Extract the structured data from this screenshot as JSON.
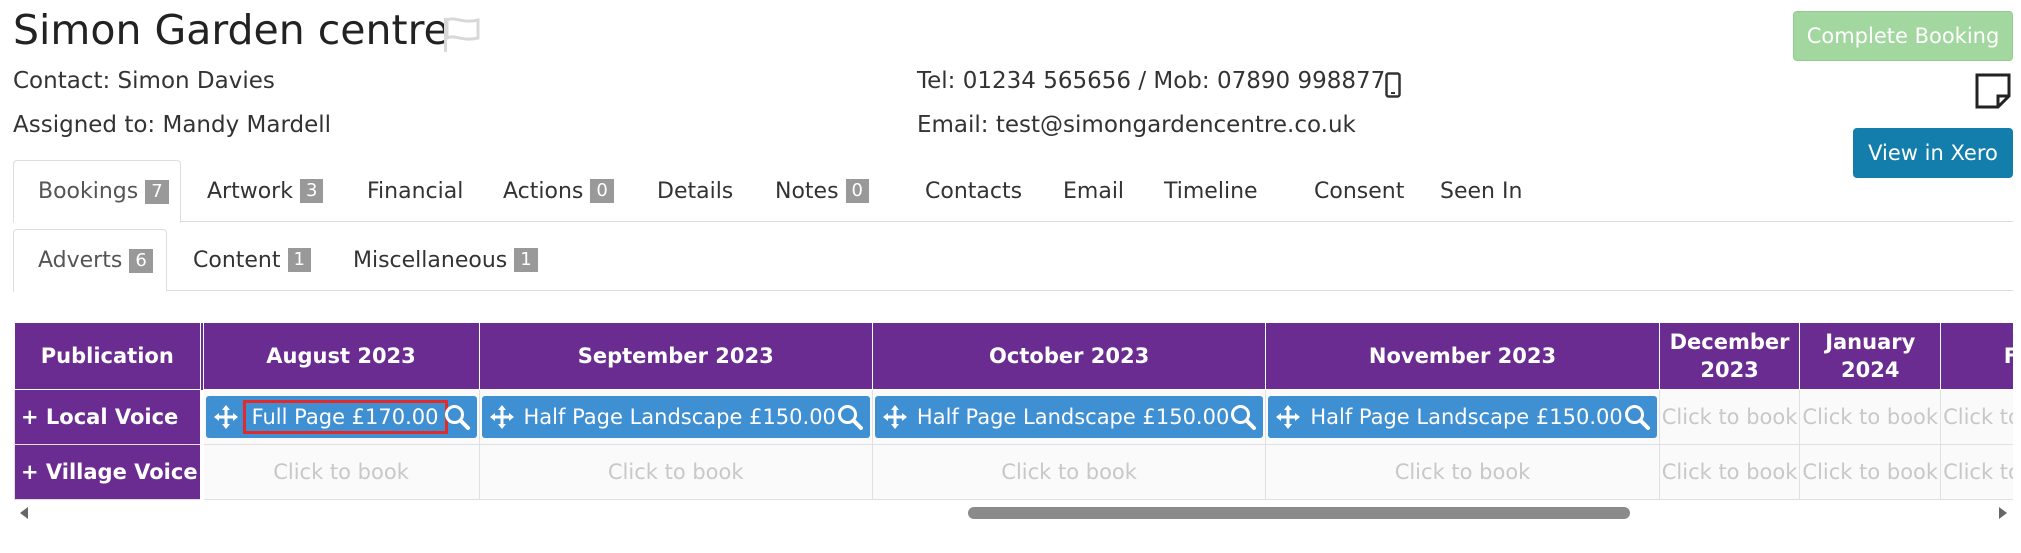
{
  "header": {
    "title": "Simon Garden centre",
    "contact": "Contact: Simon Davies",
    "assigned": "Assigned to: Mandy Mardell",
    "tel": "Tel: 01234 565656 / Mob: 07890 998877",
    "email": "Email: test@simongardencentre.co.uk",
    "complete_booking": "Complete Booking",
    "view_in_xero": "View in Xero"
  },
  "tabs": [
    {
      "label": "Bookings",
      "badge": "7"
    },
    {
      "label": "Artwork",
      "badge": "3"
    },
    {
      "label": "Financial",
      "badge": ""
    },
    {
      "label": "Actions",
      "badge": "0"
    },
    {
      "label": "Details",
      "badge": ""
    },
    {
      "label": "Notes",
      "badge": "0"
    },
    {
      "label": "Contacts",
      "badge": ""
    },
    {
      "label": "Email",
      "badge": ""
    },
    {
      "label": "Timeline",
      "badge": ""
    },
    {
      "label": "Consent",
      "badge": ""
    },
    {
      "label": "Seen In",
      "badge": ""
    }
  ],
  "subtabs": [
    {
      "label": "Adverts",
      "badge": "6"
    },
    {
      "label": "Content",
      "badge": "1"
    },
    {
      "label": "Miscellaneous",
      "badge": "1"
    }
  ],
  "grid": {
    "pub_header": "Publication",
    "months": [
      "August 2023",
      "September 2023",
      "October 2023",
      "November 2023",
      "December 2023",
      "January 2024",
      "F"
    ],
    "click_to_book": "Click to book",
    "rows": [
      {
        "name": "+ Local Voice",
        "bookings": [
          "Full Page £170.00",
          "Half Page Landscape £150.00",
          "Half Page Landscape £150.00",
          "Half Page Landscape £150.00"
        ]
      },
      {
        "name": "+ Village Voice",
        "bookings": []
      }
    ]
  },
  "colors": {
    "purple": "#6a2c91",
    "booking_blue": "#3f8fd3",
    "xero_blue": "#137eab",
    "green": "#a3d7a0"
  }
}
